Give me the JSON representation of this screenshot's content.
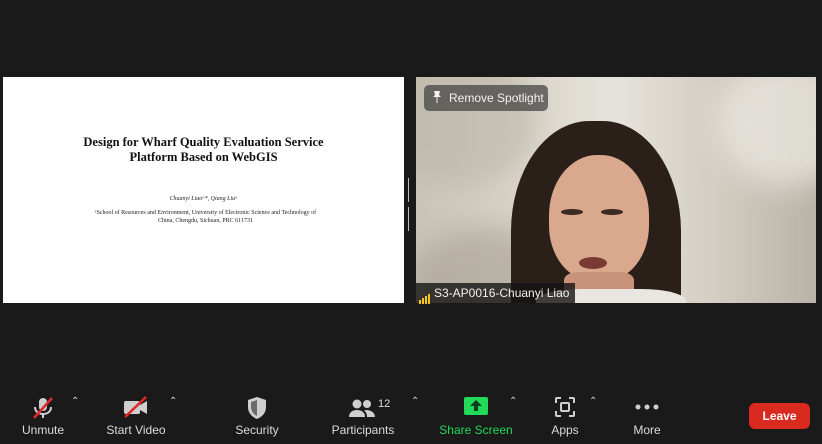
{
  "shared_screen": {
    "title_line1": "Design for Wharf Quality Evaluation Service",
    "title_line2": "Platform Based on WebGIS",
    "authors": "Chuanyi Liaoᵃ*, Qiang Liuᵃ",
    "affiliation_line1": "ᵃSchool of Resources and Environment, University of Electronic Science and Technology of",
    "affiliation_line2": "China, Chengdu, Sichuan, PRC 611731"
  },
  "video": {
    "remove_spotlight_label": "Remove Spotlight",
    "participant_name": "S3-AP0016-Chuanyi Liao"
  },
  "toolbar": {
    "unmute_label": "Unmute",
    "start_video_label": "Start Video",
    "security_label": "Security",
    "participants_label": "Participants",
    "participants_count": "12",
    "share_screen_label": "Share Screen",
    "apps_label": "Apps",
    "more_label": "More",
    "leave_label": "Leave"
  },
  "colors": {
    "background": "#1a1a1a",
    "share_green": "#23d959",
    "leave_red": "#d82a1f",
    "muted_red": "#e02828"
  }
}
